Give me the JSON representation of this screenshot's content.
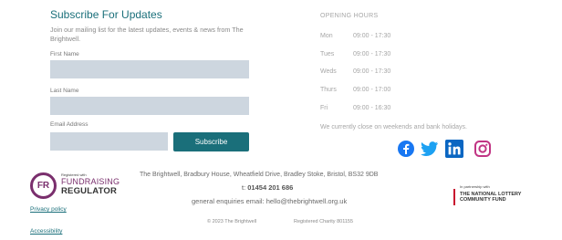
{
  "subscribe": {
    "title": "Subscribe For Updates",
    "description": "Join our mailing list for the latest updates, events & news from The Brightwell.",
    "first_name_label": "First Name",
    "last_name_label": "Last Name",
    "email_label": "Email Address",
    "button_label": "Subscribe",
    "accent_color": "#1a6f7a",
    "field_color": "#cdd6df"
  },
  "hours": {
    "title": "OPENING HOURS",
    "rows": [
      {
        "day": "Mon",
        "time": "09:00 - 17:30"
      },
      {
        "day": "Tues",
        "time": "09:00 - 17:30"
      },
      {
        "day": "Weds",
        "time": "09:00 - 17:30"
      },
      {
        "day": "Thurs",
        "time": "09:00 - 17:00"
      },
      {
        "day": "Fri",
        "time": "09:00 - 16:30"
      }
    ],
    "note": "We currently close on weekends and bank holidays."
  },
  "social": {
    "icons": [
      "facebook-icon",
      "twitter-icon",
      "linkedin-icon",
      "instagram-icon"
    ],
    "colors": {
      "facebook": "#1877f2",
      "twitter": "#1da1f2",
      "linkedin": "#0a66c2",
      "instagram": "#c13584"
    }
  },
  "fundraising": {
    "registered_with": "Registered with",
    "line1": "FUNDRAISING",
    "line2": "REGULATOR",
    "mark": "FR",
    "color": "#7a2f6d"
  },
  "contact": {
    "address": "The Brightwell, Bradbury House, Wheatfield Drive, Bradley Stoke, Bristol, BS32 9DB",
    "phone_prefix": "t:",
    "phone": "01454 201 686",
    "email_line": "general enquiries email: hello@thebrightwell.org.uk"
  },
  "footer": {
    "copyright": "© 2023 The Brightwell",
    "charity": "Registered Charity 801155",
    "privacy": "Privacy policy",
    "accessibility": "Accessibility"
  },
  "partner": {
    "small": "In partnership with",
    "name": "THE NATIONAL LOTTERY COMMUNITY FUND"
  }
}
